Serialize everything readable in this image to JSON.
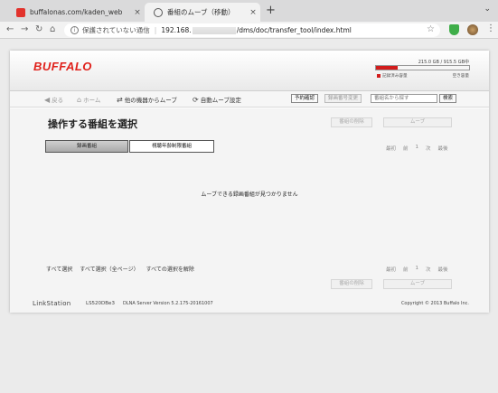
{
  "browser": {
    "tabs": [
      {
        "title": "buffalonas.com/kaden_web",
        "close": "×"
      },
      {
        "title": "番組のムーブ（移動）",
        "close": "×"
      }
    ],
    "new_tab": "+",
    "window_control": "⌄",
    "nav": {
      "back": "←",
      "forward": "→",
      "reload": "↻",
      "home": "⌂"
    },
    "address": {
      "info_glyph": "i",
      "insecure_label": "保護されていない通信",
      "separator": "|",
      "host": "192.168.",
      "path": "/dms/doc/transfer_tool/index.html",
      "star": "☆"
    },
    "menu": "⋮"
  },
  "header": {
    "logo": "BUFFALO",
    "capacity": {
      "text": "215.0 GB / 915.5 GB中",
      "used_fraction": 0.235,
      "used_label": "記録済み容量",
      "free_label": "空き容量"
    }
  },
  "navbar": {
    "back": {
      "glyph": "◀",
      "label": "戻る"
    },
    "home": {
      "glyph": "⌂",
      "label": "ホーム"
    },
    "from_other": {
      "glyph": "⇄",
      "label": "他の機器からムーブ"
    },
    "auto_move": {
      "glyph": "⟳",
      "label": "自動ムーブ設定"
    },
    "reservation_button": "予約確認",
    "change_number_button": "録画番号変更",
    "search_placeholder": "番組名から探す",
    "search_button": "検索"
  },
  "content": {
    "title": "操作する番組を選択",
    "delete_button": "番組の削除",
    "move_button": "ムーブ",
    "tabs": {
      "recorded": "録画番組",
      "restricted": "視聴年齢制限番組"
    },
    "pager": {
      "first": "最初",
      "prev": "前",
      "page": "1",
      "next": "次",
      "last": "最後"
    },
    "empty_message": "ムーブできる録画番組が見つかりません",
    "bulk": {
      "select_all": "すべて選択",
      "select_all_pages": "すべて選択（全ページ）",
      "clear_all": "すべての選択を解除"
    }
  },
  "footer": {
    "brand": "LinkStation",
    "model": "LS520DBe3",
    "version": "DLNA Server Version 5.2.175-20161007",
    "copyright": "Copyright © 2013 Buffalo Inc."
  },
  "colors": {
    "brand_red": "#e0211b",
    "capacity_red": "#d21c1c"
  }
}
